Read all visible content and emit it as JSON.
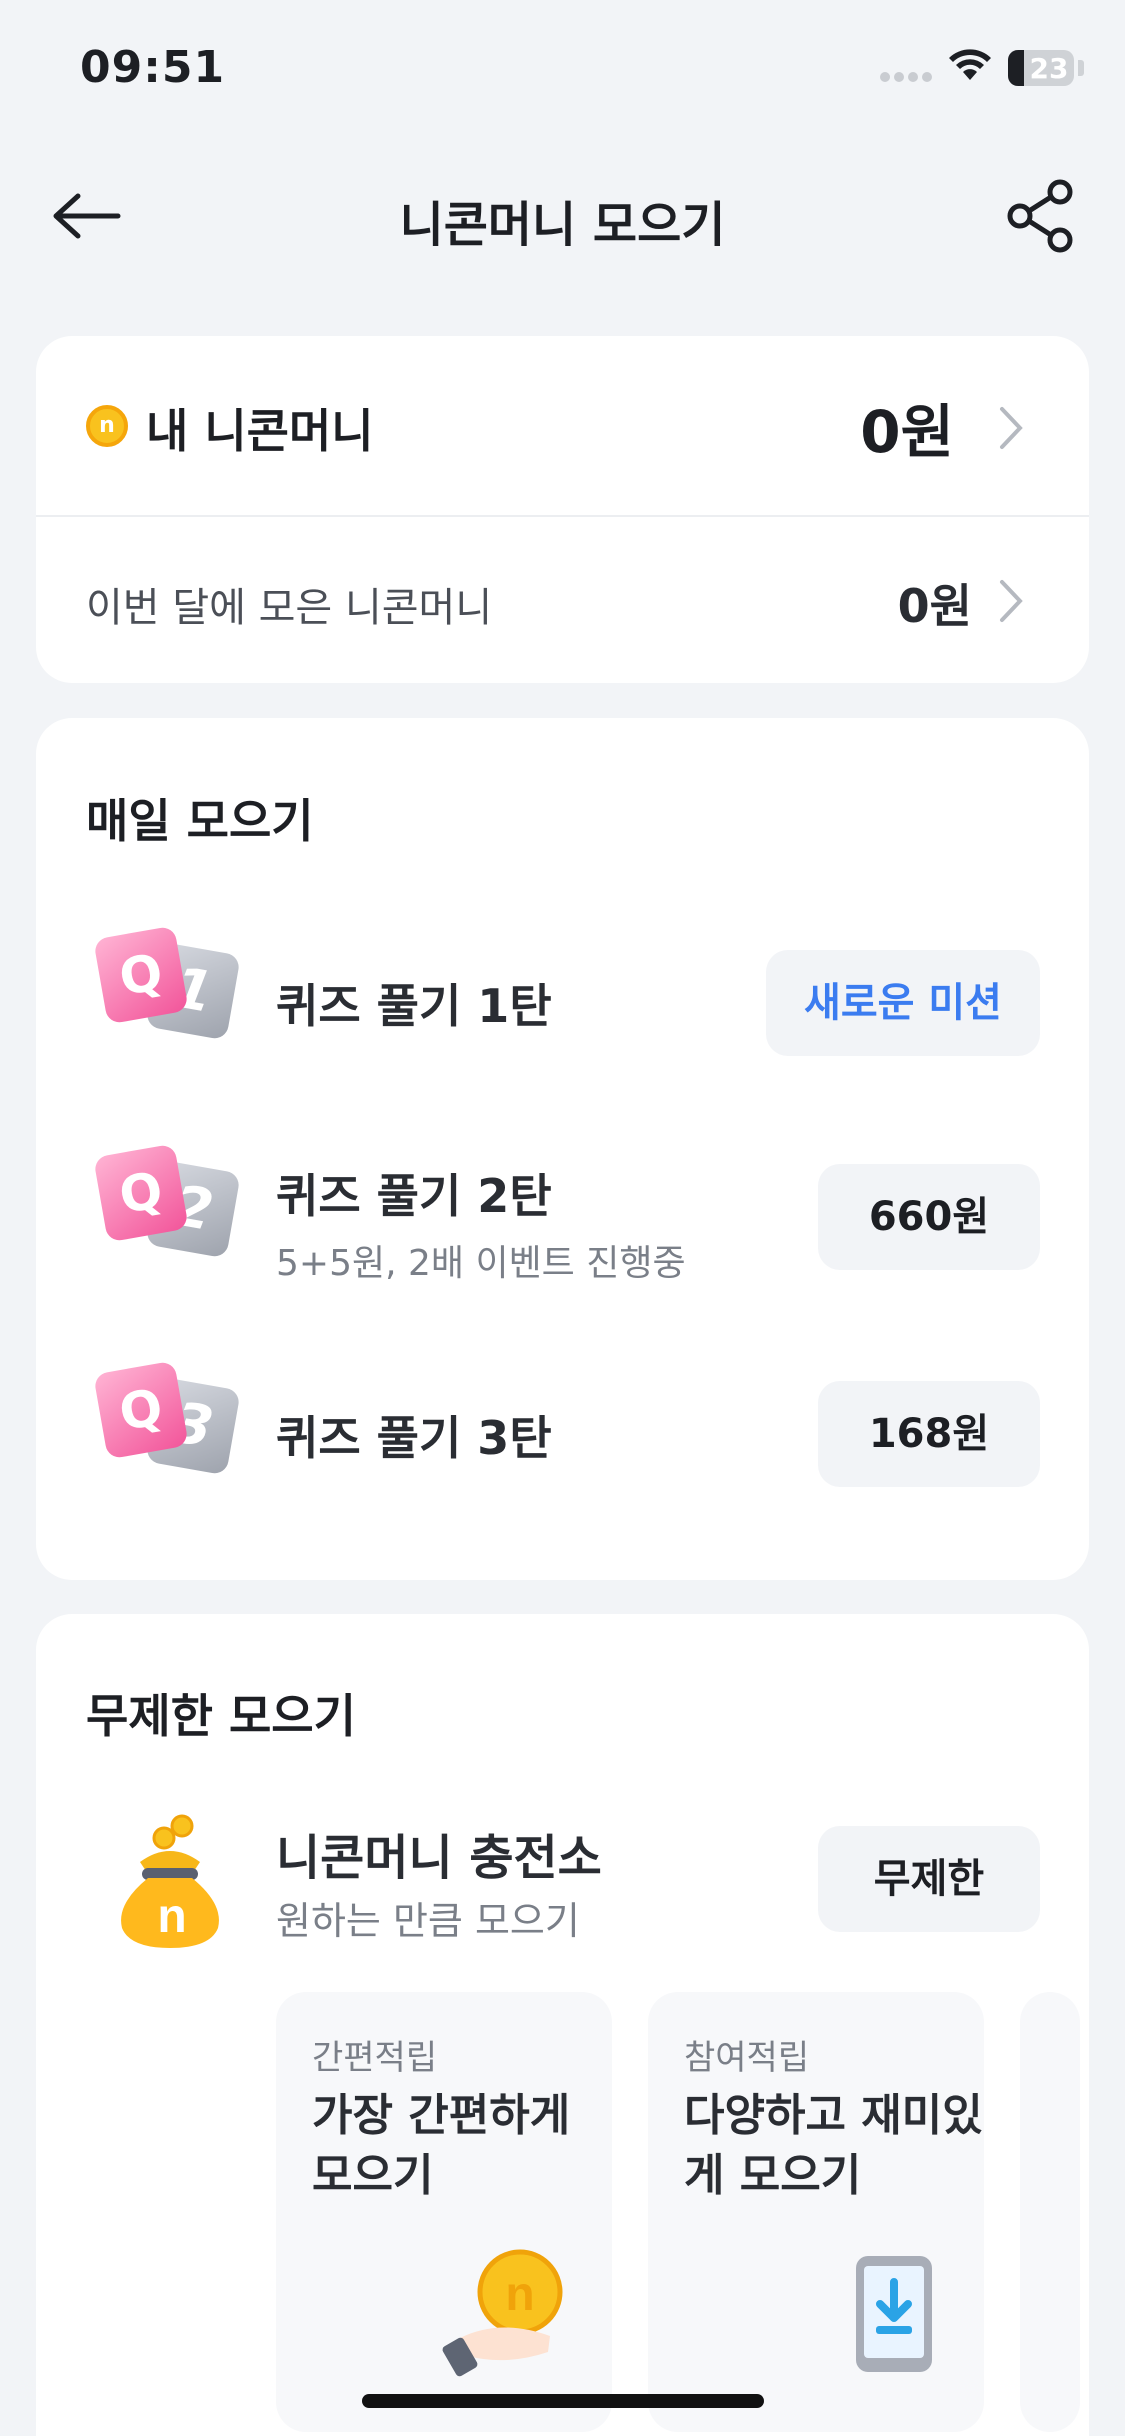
{
  "status_bar": {
    "time": "09:51",
    "battery": "23"
  },
  "header": {
    "title": "니콘머니 모으기"
  },
  "balance": {
    "my_label": "내 니콘머니",
    "my_amount": "0원",
    "month_label": "이번 달에 모은 니콘머니",
    "month_amount": "0원"
  },
  "daily": {
    "title": "매일 모으기",
    "items": [
      {
        "badge": "1",
        "title": "퀴즈 풀기 1탄",
        "subtitle": "",
        "button": "새로운 미션"
      },
      {
        "badge": "2",
        "title": "퀴즈 풀기 2탄",
        "subtitle": "5+5원, 2배 이벤트 진행중",
        "button": "660원"
      },
      {
        "badge": "3",
        "title": "퀴즈 풀기 3탄",
        "subtitle": "",
        "button": "168원"
      }
    ]
  },
  "unlimited": {
    "title": "무제한 모으기",
    "charge_title": "니콘머니 충전소",
    "charge_sub": "원하는 만큼 모으기",
    "button": "무제한",
    "cards": [
      {
        "tag": "간편적립",
        "title": "가장 간편하게 모으기"
      },
      {
        "tag": "참여적립",
        "title": "다양하고 재미있게 모으기"
      }
    ]
  },
  "colors": {
    "accent": "#3b7cf0",
    "coin": "#f9c21e",
    "quiz_pink": "#f2559a"
  },
  "icons": [
    "back-arrow-icon",
    "share-icon",
    "coin-icon",
    "chevron-right-icon",
    "quiz-badge-icon",
    "money-bag-icon",
    "coin-hand-icon",
    "phone-download-icon"
  ]
}
